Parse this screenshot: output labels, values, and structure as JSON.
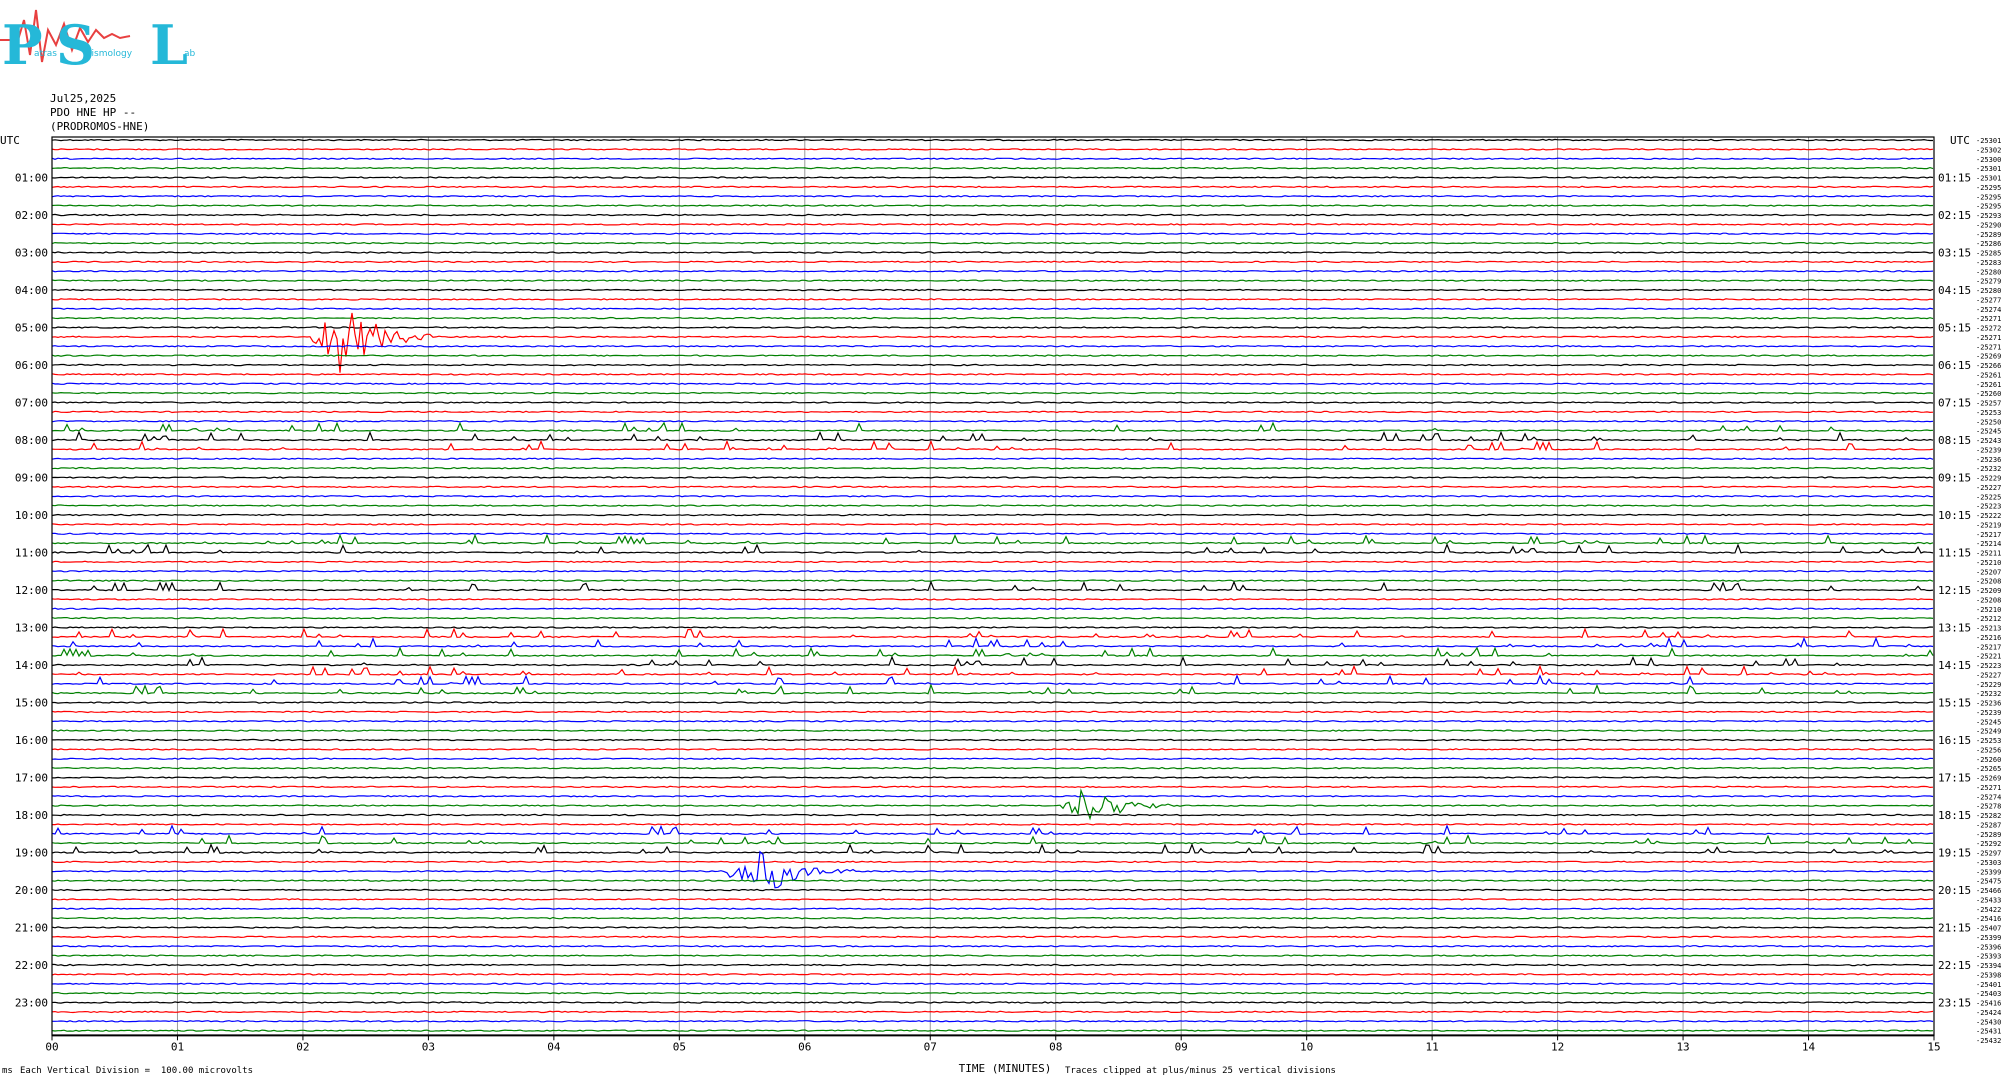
{
  "header": {
    "logo_letters": "PSL",
    "logo_words": [
      "atras",
      "eismology",
      "ab"
    ],
    "date": "Jul25,2025",
    "station": "PDO HNE HP --",
    "location": "(PRODROMOS-HNE)"
  },
  "chart_data": {
    "type": "line",
    "title": "",
    "xlabel": "TIME (MINUTES)",
    "left_axis_title": "UTC",
    "right_axis_title": "UTC",
    "x_ticks": [
      "00",
      "01",
      "02",
      "03",
      "04",
      "05",
      "06",
      "07",
      "08",
      "09",
      "10",
      "11",
      "12",
      "13",
      "14",
      "15"
    ],
    "xlim": [
      0,
      15
    ],
    "left_hour_labels": [
      "01:00",
      "02:00",
      "03:00",
      "04:00",
      "05:00",
      "06:00",
      "07:00",
      "08:00",
      "09:00",
      "10:00",
      "11:00",
      "12:00",
      "13:00",
      "14:00",
      "15:00",
      "16:00",
      "17:00",
      "18:00",
      "19:00",
      "20:00",
      "21:00",
      "22:00",
      "23:00"
    ],
    "right_hour_labels": [
      "01:15",
      "02:15",
      "03:15",
      "04:15",
      "05:15",
      "06:15",
      "07:15",
      "08:15",
      "09:15",
      "10:15",
      "11:15",
      "12:15",
      "13:15",
      "14:15",
      "15:15",
      "16:15",
      "17:15",
      "18:15",
      "19:15",
      "20:15",
      "21:15",
      "22:15",
      "23:15"
    ],
    "trace_colors": [
      "#000000",
      "#ff0000",
      "#0000ff",
      "#008000"
    ],
    "trace_count": 96,
    "minutes_per_trace": 15,
    "right_offsets": [
      "-25301",
      "-25302",
      "-25300",
      "-25301",
      "-25301",
      "-25295",
      "-25295",
      "-25295",
      "-25293",
      "-25290",
      "-25289",
      "-25286",
      "-25285",
      "-25283",
      "-25280",
      "-25279",
      "-25280",
      "-25277",
      "-25274",
      "-25271",
      "-25272",
      "-25271",
      "-25271",
      "-25269",
      "-25266",
      "-25261",
      "-25261",
      "-25260",
      "-25257",
      "-25253",
      "-25250",
      "-25245",
      "-25243",
      "-25239",
      "-25236",
      "-25232",
      "-25229",
      "-25227",
      "-25225",
      "-25223",
      "-25222",
      "-25219",
      "-25217",
      "-25214",
      "-25211",
      "-25210",
      "-25207",
      "-25208",
      "-25209",
      "-25208",
      "-25210",
      "-25212",
      "-25213",
      "-25216",
      "-25217",
      "-25221",
      "-25223",
      "-25227",
      "-25229",
      "-25232",
      "-25236",
      "-25239",
      "-25245",
      "-25249",
      "-25253",
      "-25256",
      "-25260",
      "-25265",
      "-25269",
      "-25271",
      "-25274",
      "-25278",
      "-25282",
      "-25287",
      "-25289",
      "-25292",
      "-25297",
      "-25303",
      "-25399",
      "-25475",
      "-25466",
      "-25433",
      "-25422",
      "-25416",
      "-25407",
      "-25399",
      "-25396",
      "-25393",
      "-25394",
      "-25398",
      "-25401",
      "-25403",
      "-25416",
      "-25424",
      "-25430",
      "-25431",
      "-25432"
    ],
    "events": [
      {
        "trace": 21,
        "start_minute": 2.05,
        "peak_minute": 2.3,
        "end_minute": 3.1,
        "amplitude_divisions": 4
      },
      {
        "trace": 71,
        "start_minute": 8.0,
        "peak_minute": 8.3,
        "end_minute": 8.9,
        "amplitude_divisions": 2.5
      },
      {
        "trace": 78,
        "start_minute": 5.3,
        "peak_minute": 5.7,
        "end_minute": 6.4,
        "amplitude_divisions": 2.5
      }
    ],
    "noisy_traces": [
      31,
      32,
      33,
      43,
      44,
      48,
      53,
      54,
      55,
      56,
      57,
      58,
      59,
      74,
      75,
      76
    ],
    "scale_note": "Each Vertical Division =  100.00 microvolts",
    "clip_note": "Traces clipped at plus/minus 25 vertical divisions",
    "corner_label": "ms"
  }
}
